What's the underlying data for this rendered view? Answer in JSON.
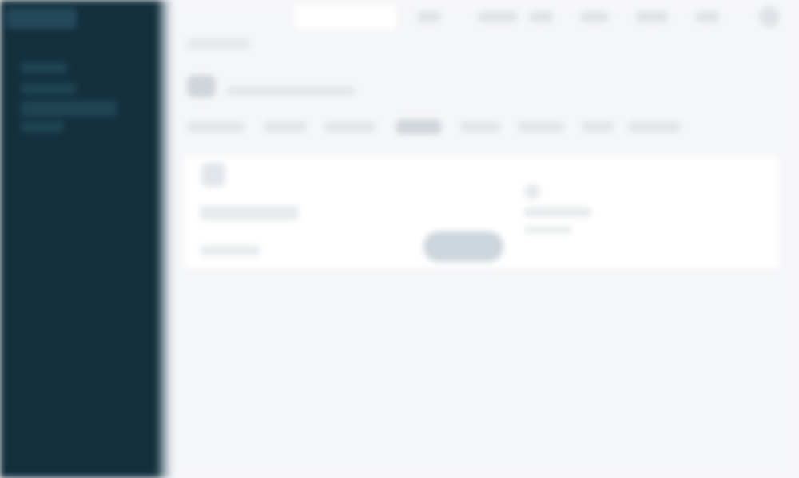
{
  "sidebar": {
    "logo_icon": "app-logo-icon",
    "items": [
      {
        "label": ""
      },
      {
        "label": ""
      },
      {
        "label": ""
      },
      {
        "label": ""
      }
    ]
  },
  "topbar": {
    "search": {
      "placeholder": ""
    },
    "chips": [
      {
        "label": ""
      },
      {
        "label": ""
      },
      {
        "label": ""
      },
      {
        "label": ""
      },
      {
        "label": ""
      },
      {
        "label": ""
      }
    ]
  },
  "main": {
    "breadcrumb": "",
    "title": "",
    "tabs": [
      {
        "label": ""
      },
      {
        "label": ""
      },
      {
        "label": ""
      },
      {
        "label": ""
      },
      {
        "label": ""
      },
      {
        "label": ""
      },
      {
        "label": ""
      },
      {
        "label": ""
      }
    ],
    "active_tab_index": 3,
    "card": {
      "heading": "",
      "subtext": "",
      "button_label": "",
      "right_heading": "",
      "right_text": ""
    }
  },
  "colors": {
    "sidebar_bg": "#132f3d",
    "page_bg": "#f5f6f8",
    "card_bg": "#ffffff",
    "button_bg": "#cdd6dc"
  }
}
